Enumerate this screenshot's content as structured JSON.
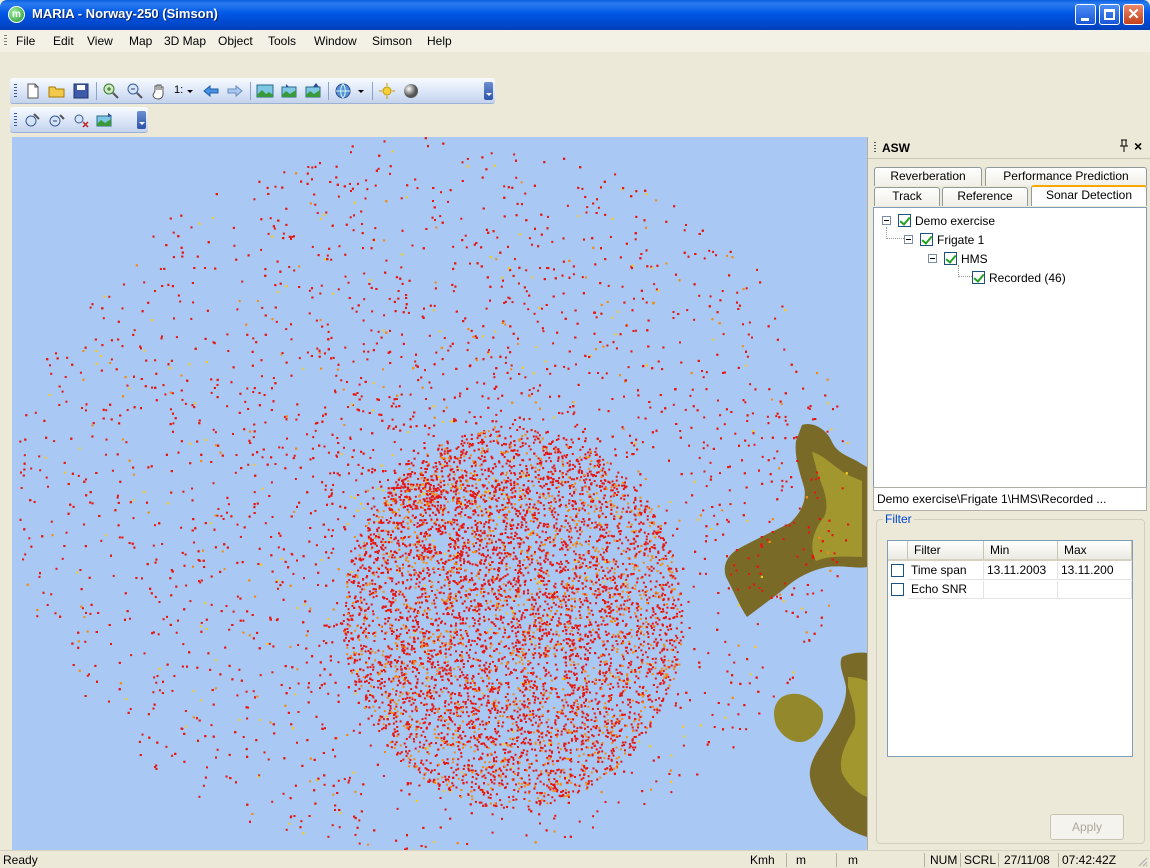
{
  "window": {
    "title": "MARIA - Norway-250 (Simson)",
    "app_icon": "m"
  },
  "menu": [
    "File",
    "Edit",
    "View",
    "Map",
    "3D Map",
    "Object",
    "Tools",
    "Window",
    "Simson",
    "Help"
  ],
  "toolbar": {
    "zoom_label": "1:"
  },
  "asw_panel": {
    "title": "ASW",
    "pin_icon": "pin-icon",
    "close_label": "×",
    "tabs_row1": [
      "Reverberation",
      "Performance Prediction"
    ],
    "tabs_row2": [
      "Track",
      "Reference",
      "Sonar Detection"
    ],
    "active_tab": "Sonar Detection",
    "tree": [
      {
        "label": "Demo exercise",
        "checked": true
      },
      {
        "label": "Frigate 1",
        "checked": true
      },
      {
        "label": "HMS",
        "checked": true
      },
      {
        "label": "Recorded (46)",
        "checked": true
      }
    ],
    "selected_path": "Demo exercise\\Frigate 1\\HMS\\Recorded ...",
    "filter": {
      "group_label": "Filter",
      "columns": [
        "Filter",
        "Min",
        "Max"
      ],
      "rows": [
        {
          "filter": "Time span",
          "min": "13.11.2003",
          "max": "13.11.200",
          "checked": false
        },
        {
          "filter": "Echo SNR",
          "min": "",
          "max": "",
          "checked": false
        }
      ]
    },
    "apply_label": "Apply"
  },
  "colors": {
    "sea": "#a9c9f4",
    "land_dark": "#7a6a28",
    "land_light": "#a2962e",
    "detection_red": "#e8150e",
    "detection_orange": "#f48a10",
    "detection_yellow": "#f7c81c"
  },
  "statusbar": {
    "ready": "Ready",
    "speed_unit": "Kmh",
    "unit1": "m",
    "unit2": "m",
    "num": "NUM",
    "scrl": "SCRL",
    "date": "27/11/08",
    "time": "07:42:42Z"
  }
}
